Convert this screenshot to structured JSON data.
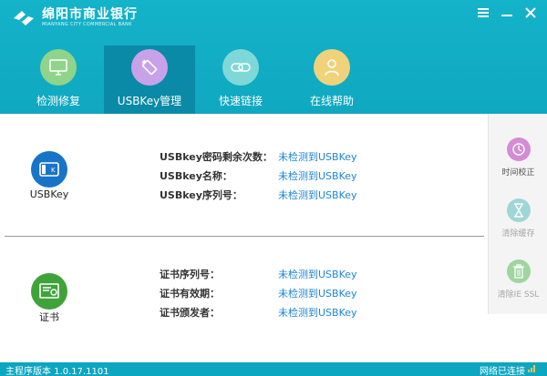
{
  "app": {
    "name_cn": "绵阳市商业银行",
    "name_en": "MIANYANG CITY COMMERCIAL BANK"
  },
  "window_controls": [
    "menu-icon",
    "minimize-icon",
    "close-icon"
  ],
  "tabs": [
    {
      "label": "检测修复",
      "icon": "monitor-icon",
      "active": false
    },
    {
      "label": "USBKey管理",
      "icon": "usbkey-icon",
      "active": true
    },
    {
      "label": "快速链接",
      "icon": "link-icon",
      "active": false
    },
    {
      "label": "在线帮助",
      "icon": "user-icon",
      "active": false
    }
  ],
  "usbkey": {
    "label": "USBKey",
    "fields": [
      {
        "key": "USBkey密码剩余次数：",
        "value": "未检测到USBKey"
      },
      {
        "key": "USBkey名称：",
        "value": "未检测到USBKey"
      },
      {
        "key": "USBkey序列号：",
        "value": "未检测到USBKey"
      }
    ]
  },
  "cert": {
    "label": "证书",
    "fields": [
      {
        "key": "证书序列号：",
        "value": "未检测到USBKey"
      },
      {
        "key": "证书有效期：",
        "value": "未检测到USBKey"
      },
      {
        "key": "证书颁发者：",
        "value": "未检测到USBKey"
      }
    ]
  },
  "sidebar": [
    {
      "label": "时间校正",
      "icon": "clock-icon",
      "enabled": true
    },
    {
      "label": "清除缓存",
      "icon": "hourglass-icon",
      "enabled": false
    },
    {
      "label": "清除IE SSL",
      "icon": "trash-icon",
      "enabled": false
    }
  ],
  "status": {
    "version": "主程序版本 1.0.17.1101",
    "network": "网络已连接"
  },
  "colors": {
    "header": "#14b3c9",
    "active_tab": "#0a8aa6",
    "link": "#1c85d4",
    "tab_icon_green": "#8fd48a",
    "tab_icon_purple": "#c8a2e8",
    "tab_icon_teal": "#7fd8d8",
    "tab_icon_yellow": "#f0d27a"
  }
}
